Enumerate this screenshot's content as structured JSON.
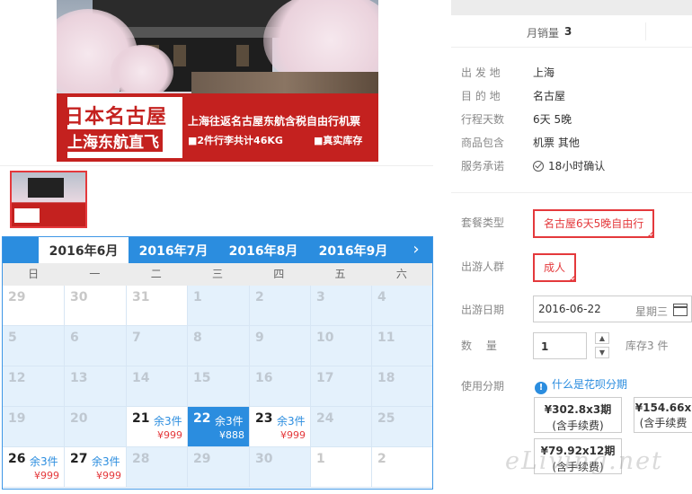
{
  "hero": {
    "title_line1": "日本名古屋",
    "title_line2": "上海东航直飞",
    "desc1": "上海往返名古屋东航含税自由行机票",
    "desc2": "■2件行李共计46KG",
    "desc3": "■真实库存"
  },
  "calendar": {
    "tabs": [
      {
        "label": "2016年6月",
        "active": true
      },
      {
        "label": "2016年7月",
        "active": false
      },
      {
        "label": "2016年8月",
        "active": false
      },
      {
        "label": "2016年9月",
        "active": false
      }
    ],
    "next_icon": "chevron-right-icon",
    "weekdays": [
      "日",
      "一",
      "二",
      "三",
      "四",
      "五",
      "六"
    ],
    "days": [
      {
        "num": "29",
        "state": "gray"
      },
      {
        "num": "30",
        "state": "gray"
      },
      {
        "num": "31",
        "state": "gray"
      },
      {
        "num": "1",
        "state": "blue"
      },
      {
        "num": "2",
        "state": "blue"
      },
      {
        "num": "3",
        "state": "blue"
      },
      {
        "num": "4",
        "state": "blue"
      },
      {
        "num": "5",
        "state": "blue"
      },
      {
        "num": "6",
        "state": "blue"
      },
      {
        "num": "7",
        "state": "blue"
      },
      {
        "num": "8",
        "state": "blue"
      },
      {
        "num": "9",
        "state": "blue"
      },
      {
        "num": "10",
        "state": "blue"
      },
      {
        "num": "11",
        "state": "blue"
      },
      {
        "num": "12",
        "state": "blue"
      },
      {
        "num": "13",
        "state": "blue"
      },
      {
        "num": "14",
        "state": "blue"
      },
      {
        "num": "15",
        "state": "blue"
      },
      {
        "num": "16",
        "state": "blue"
      },
      {
        "num": "17",
        "state": "blue"
      },
      {
        "num": "18",
        "state": "blue"
      },
      {
        "num": "19",
        "state": "blue"
      },
      {
        "num": "20",
        "state": "blue"
      },
      {
        "num": "21",
        "state": "avail",
        "stock": "余3件",
        "price": "¥999"
      },
      {
        "num": "22",
        "state": "sel",
        "stock": "余3件",
        "price": "¥888"
      },
      {
        "num": "23",
        "state": "avail",
        "stock": "余3件",
        "price": "¥999"
      },
      {
        "num": "24",
        "state": "blue"
      },
      {
        "num": "25",
        "state": "blue"
      },
      {
        "num": "26",
        "state": "avail",
        "stock": "余3件",
        "price": "¥999"
      },
      {
        "num": "27",
        "state": "avail",
        "stock": "余3件",
        "price": "¥999"
      },
      {
        "num": "28",
        "state": "blue"
      },
      {
        "num": "29",
        "state": "blue"
      },
      {
        "num": "30",
        "state": "blue"
      },
      {
        "num": "1",
        "state": "gray"
      },
      {
        "num": "2",
        "state": "gray"
      }
    ]
  },
  "sales": {
    "label": "月销量",
    "value": "3"
  },
  "info": [
    {
      "key": "出 发 地",
      "value": "上海"
    },
    {
      "key": "目 的 地",
      "value": "名古屋"
    },
    {
      "key": "行程天数",
      "value": "6天 5晚"
    },
    {
      "key": "商品包含",
      "value": "机票  其他"
    },
    {
      "key": "服务承诺",
      "value": "18小时确认",
      "icon": "check-circle-icon"
    }
  ],
  "package": {
    "label": "套餐类型",
    "option": "名古屋6天5晚自由行"
  },
  "traveler": {
    "label": "出游人群",
    "option": "成人"
  },
  "date": {
    "label": "出游日期",
    "value": "2016-06-22",
    "weekday": "星期三",
    "icon": "calendar-icon"
  },
  "quantity": {
    "label": "数　 量",
    "value": "1",
    "stock": "库存3 件",
    "up_icon": "up-arrow-icon",
    "down_icon": "down-arrow-icon"
  },
  "installment": {
    "label": "使用分期",
    "link": "什么是花呗分期",
    "info_icon": "info-icon",
    "options": [
      {
        "amount": "¥302.8x3期",
        "fee": "(含手续费)"
      },
      {
        "amount": "¥154.66x",
        "fee": "(含手续费"
      },
      {
        "amount": "¥79.92x12期",
        "fee": "(含手续费)"
      }
    ]
  },
  "watermark": "eLiving.net"
}
